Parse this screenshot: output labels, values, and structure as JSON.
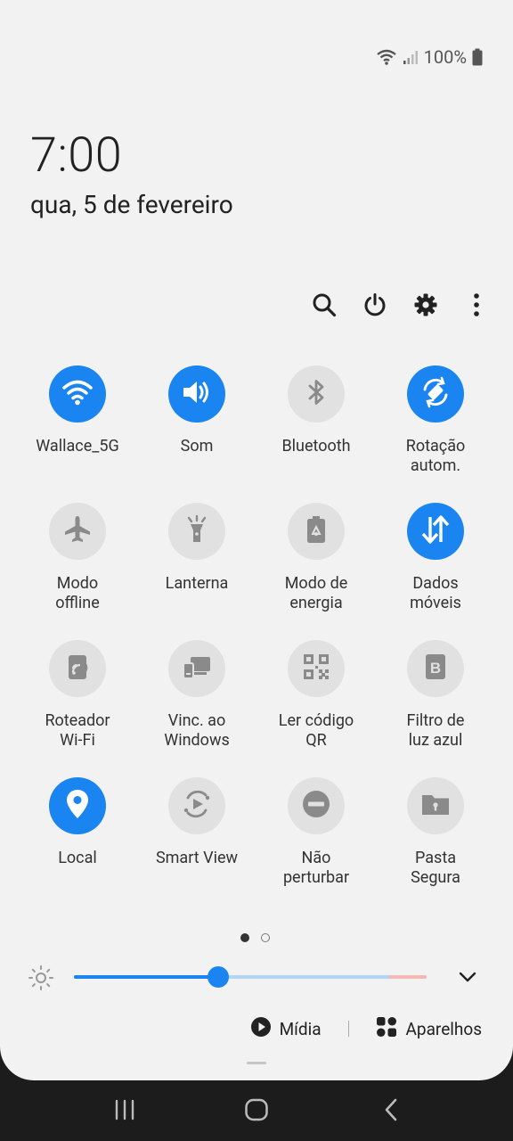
{
  "status": {
    "battery_text": "100%"
  },
  "header": {
    "time": "7:00",
    "date": "qua, 5 de fevereiro"
  },
  "toolbar": {
    "search_icon": "search-icon",
    "power_icon": "power-icon",
    "settings_icon": "gear-icon",
    "more_icon": "more-vertical-icon"
  },
  "tiles": [
    {
      "label": "Wallace_5G",
      "icon": "wifi-icon",
      "active": true
    },
    {
      "label": "Som",
      "icon": "volume-icon",
      "active": true
    },
    {
      "label": "Bluetooth",
      "icon": "bluetooth-icon",
      "active": false
    },
    {
      "label": "Rotação\nautom.",
      "icon": "auto-rotate-icon",
      "active": true
    },
    {
      "label": "Modo\noffline",
      "icon": "airplane-icon",
      "active": false
    },
    {
      "label": "Lanterna",
      "icon": "flashlight-icon",
      "active": false
    },
    {
      "label": "Modo de\nenergia",
      "icon": "battery-saver-icon",
      "active": false
    },
    {
      "label": "Dados\nmóveis",
      "icon": "mobile-data-icon",
      "active": true
    },
    {
      "label": "Roteador\nWi-Fi",
      "icon": "hotspot-icon",
      "active": false
    },
    {
      "label": "Vinc. ao\nWindows",
      "icon": "link-to-windows-icon",
      "active": false
    },
    {
      "label": "Ler código\nQR",
      "icon": "qr-code-icon",
      "active": false
    },
    {
      "label": "Filtro de\nluz azul",
      "icon": "blue-light-filter-icon",
      "active": false
    },
    {
      "label": "Local",
      "icon": "location-icon",
      "active": true
    },
    {
      "label": "Smart View",
      "icon": "smart-view-icon",
      "active": false
    },
    {
      "label": "Não\nperturbar",
      "icon": "do-not-disturb-icon",
      "active": false
    },
    {
      "label": "Pasta\nSegura",
      "icon": "secure-folder-icon",
      "active": false
    }
  ],
  "pager": {
    "current_page": 1,
    "total_pages": 2
  },
  "brightness": {
    "level": 0.41
  },
  "bottom": {
    "media_label": "Mídia",
    "devices_label": "Aparelhos"
  },
  "colors": {
    "accent": "#1a85f0",
    "tile_off": "#e1e1e1",
    "icon_off": "#8a8a8a",
    "background": "#f2f2f2"
  }
}
